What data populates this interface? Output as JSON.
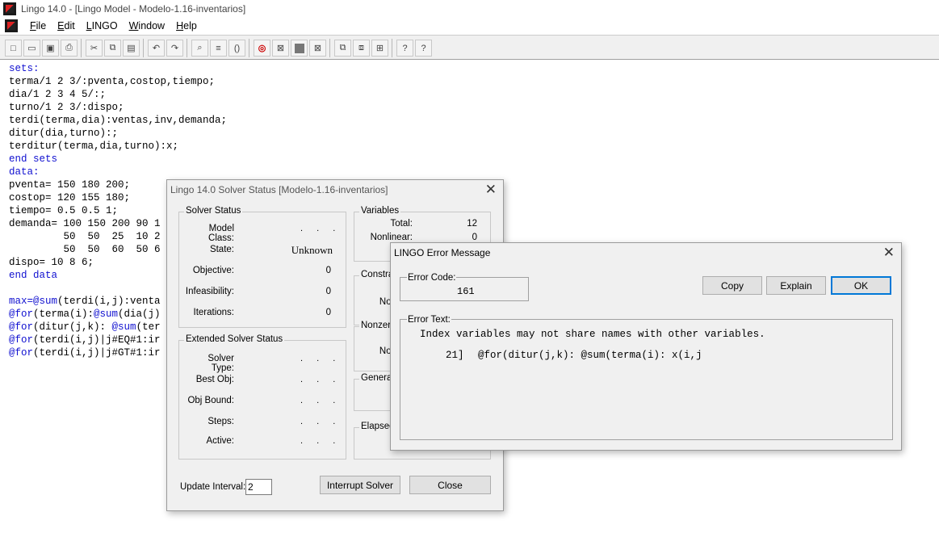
{
  "window": {
    "title": "Lingo 14.0 - [Lingo Model - Modelo-1.16-inventarios]"
  },
  "menu": {
    "items": [
      {
        "label": "File",
        "key": "F",
        "rest": "ile"
      },
      {
        "label": "Edit",
        "key": "E",
        "rest": "dit"
      },
      {
        "label": "LINGO",
        "key": "L",
        "rest": "INGO"
      },
      {
        "label": "Window",
        "key": "W",
        "rest": "indow"
      },
      {
        "label": "Help",
        "key": "H",
        "rest": "elp"
      }
    ]
  },
  "toolbar": {
    "buttons": [
      "new-icon",
      "open-icon",
      "save-icon",
      "print-icon",
      "cut-icon",
      "copy-icon",
      "paste-icon",
      "undo-icon",
      "redo-icon",
      "find-icon",
      "find-replace-icon",
      "match-parenthesis-icon",
      "solve-icon",
      "solution-icon",
      "matrix-picture-icon",
      "close-all-icon",
      "send-to-back-icon",
      "tile-icon",
      "cascade-icon",
      "help-icon",
      "context-help-icon"
    ]
  },
  "editor": {
    "lines": [
      {
        "segments": [
          {
            "t": "sets:",
            "kw": true
          }
        ]
      },
      {
        "segments": [
          {
            "t": "terma/1 2 3/:pventa,costop,tiempo;",
            "kw": false
          }
        ]
      },
      {
        "segments": [
          {
            "t": "dia/1 2 3 4 5/:;",
            "kw": false
          }
        ]
      },
      {
        "segments": [
          {
            "t": "turno/1 2 3/:dispo;",
            "kw": false
          }
        ]
      },
      {
        "segments": [
          {
            "t": "terdi(terma,dia):ventas,inv,demanda;",
            "kw": false
          }
        ]
      },
      {
        "segments": [
          {
            "t": "ditur(dia,turno):;",
            "kw": false
          }
        ]
      },
      {
        "segments": [
          {
            "t": "terditur(terma,dia,turno):x;",
            "kw": false
          }
        ]
      },
      {
        "segments": [
          {
            "t": "end sets",
            "kw": true
          }
        ]
      },
      {
        "segments": [
          {
            "t": "data:",
            "kw": true
          }
        ]
      },
      {
        "segments": [
          {
            "t": "pventa= 150 180 200;",
            "kw": false
          }
        ]
      },
      {
        "segments": [
          {
            "t": "costop= 120 155 180;",
            "kw": false
          }
        ]
      },
      {
        "segments": [
          {
            "t": "tiempo= 0.5 0.5 1;",
            "kw": false
          }
        ]
      },
      {
        "segments": [
          {
            "t": "demanda= 100 150 200 90 1",
            "kw": false
          }
        ]
      },
      {
        "segments": [
          {
            "t": "         50  50  25  10 2",
            "kw": false
          }
        ]
      },
      {
        "segments": [
          {
            "t": "         50  50  60  50 6",
            "kw": false
          }
        ]
      },
      {
        "segments": [
          {
            "t": "dispo= 10 8 6;",
            "kw": false
          }
        ]
      },
      {
        "segments": [
          {
            "t": "end data",
            "kw": true
          }
        ]
      },
      {
        "segments": [
          {
            "t": "",
            "kw": false
          }
        ]
      },
      {
        "segments": [
          {
            "t": "max=",
            "kw": true
          },
          {
            "t": "@sum",
            "kw": true
          },
          {
            "t": "(terdi(i,j):venta",
            "kw": false
          }
        ]
      },
      {
        "segments": [
          {
            "t": "@for",
            "kw": true
          },
          {
            "t": "(terma(i):",
            "kw": false
          },
          {
            "t": "@sum",
            "kw": true
          },
          {
            "t": "(dia(j)",
            "kw": false
          }
        ]
      },
      {
        "segments": [
          {
            "t": "@for",
            "kw": true
          },
          {
            "t": "(ditur(j,k): ",
            "kw": false
          },
          {
            "t": "@sum",
            "kw": true
          },
          {
            "t": "(ter",
            "kw": false
          }
        ]
      },
      {
        "segments": [
          {
            "t": "@for",
            "kw": true
          },
          {
            "t": "(terdi(i,j)|j#EQ#1:ir",
            "kw": false
          }
        ]
      },
      {
        "segments": [
          {
            "t": "@for",
            "kw": true
          },
          {
            "t": "(terdi(i,j)|j#GT#1:ir",
            "kw": false
          }
        ]
      }
    ]
  },
  "solver": {
    "title": "Lingo 14.0 Solver Status [Modelo-1.16-inventarios]",
    "status_group": "Solver Status",
    "model_class_label": "Model Class:",
    "model_class_value": ". . .",
    "state_label": "State:",
    "state_value": "Unknown",
    "objective_label": "Objective:",
    "objective_value": "0",
    "infeasibility_label": "Infeasibility:",
    "infeasibility_value": "0",
    "iterations_label": "Iterations:",
    "iterations_value": "0",
    "extended_group": "Extended Solver Status",
    "solver_type_label": "Solver Type:",
    "best_obj_label": "Best Obj:",
    "obj_bound_label": "Obj Bound:",
    "steps_label": "Steps:",
    "active_label": "Active:",
    "dots": ". . .",
    "variables_group": "Variables",
    "total_label": "Total:",
    "total_value": "12",
    "nonlinear_label": "Nonlinear:",
    "nonlinear_value": "0",
    "integer_label": "Inte",
    "constraints_group": "Constra",
    "cons_nonlinear_label": "Non",
    "nonzeros_group": "Nonzero",
    "nz_nonlinear_label": "Non",
    "generator_group": "Genera",
    "elapsed_group": "Elapsed",
    "update_interval_label": "Update Interval:",
    "update_interval_value": "2",
    "interrupt_label": "Interrupt Solver",
    "close_label": "Close"
  },
  "error": {
    "title": "LINGO Error Message",
    "code_label": "Error Code:",
    "code_value": "161",
    "copy_label": "Copy",
    "explain_label": "Explain",
    "ok_label": "OK",
    "text_label": "Error Text:",
    "message": "Index variables may not share names with other variables.",
    "line_ref": "21]",
    "line_code": "@for(ditur(j,k): @sum(terma(i): x(i,j"
  }
}
